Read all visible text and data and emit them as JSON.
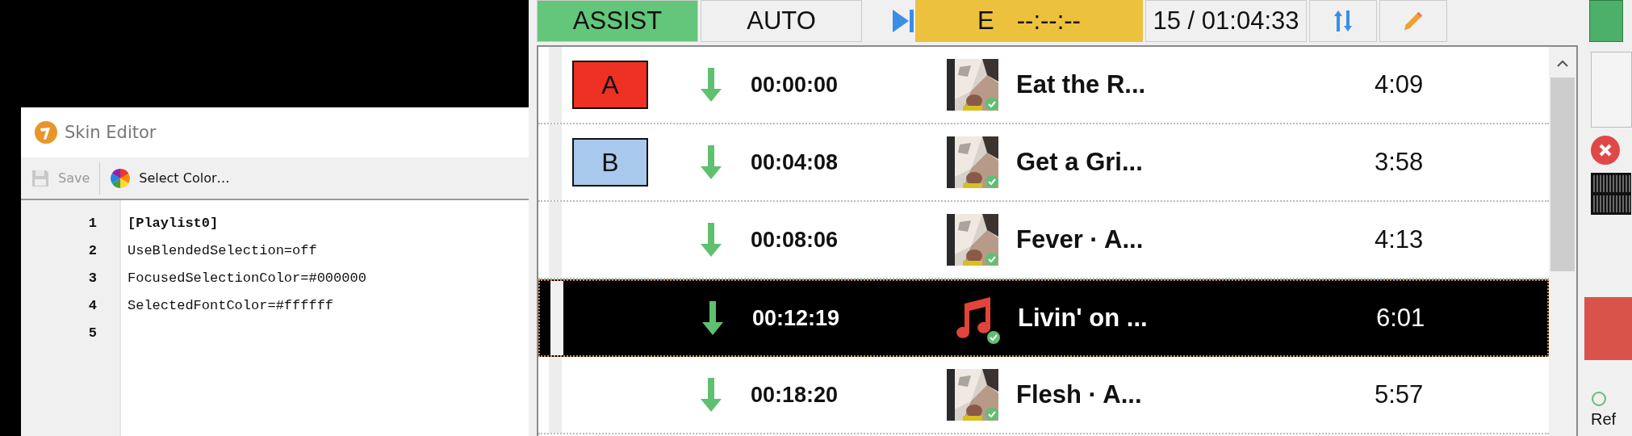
{
  "editor": {
    "title": "Skin Editor",
    "toolbar": [
      {
        "kind": "save",
        "label": "Save",
        "disabled": true
      },
      {
        "kind": "color",
        "label": "Select Color…",
        "disabled": false
      }
    ],
    "lines": [
      {
        "number": "1",
        "text": "[Playlist0]",
        "kind": "section"
      },
      {
        "number": "2",
        "text": "UseBlendedSelection=off",
        "kind": "key"
      },
      {
        "number": "3",
        "text": "FocusedSelectionColor=#000000",
        "kind": "key"
      },
      {
        "number": "4",
        "text": "SelectedFontColor=#ffffff",
        "kind": "key"
      },
      {
        "number": "5",
        "kind": "empty"
      }
    ]
  },
  "topbar": {
    "modes": [
      {
        "label": "ASSIST",
        "selected": true
      },
      {
        "label": "AUTO",
        "selected": false
      }
    ],
    "event": {
      "letter": "E",
      "time": "--:--:--"
    },
    "counter": "15 / 01:04:33"
  },
  "playlist": {
    "rows": [
      {
        "badge": "A",
        "color": "#ee3124",
        "time": "00:00:00",
        "kind": "picture",
        "title": "Eat the R...",
        "duration": "4:09",
        "selected": false
      },
      {
        "badge": "B",
        "color": "#a8c8ec",
        "time": "00:04:08",
        "kind": "picture",
        "title": "Get a Gri...",
        "duration": "3:58",
        "selected": false
      },
      {
        "time": "00:08:06",
        "kind": "picture",
        "title": "Fever · A...",
        "duration": "4:13",
        "selected": false
      },
      {
        "time": "00:12:19",
        "kind": "note",
        "title": "Livin' on ...",
        "duration": "6:01",
        "selected": true
      },
      {
        "time": "00:18:20",
        "kind": "picture",
        "title": "Flesh · A...",
        "duration": "5:57",
        "selected": false
      }
    ]
  },
  "side": {
    "label": "Ref"
  }
}
